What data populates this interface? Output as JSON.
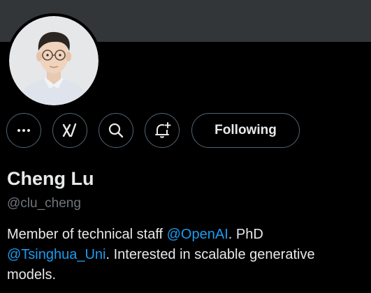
{
  "profile": {
    "display_name": "Cheng Lu",
    "handle": "@clu_cheng",
    "avatar_alt": "avatar",
    "bio": {
      "part1": "Member of technical staff ",
      "mention1": "@OpenAI",
      "part2": ". PhD ",
      "mention2": "@Tsinghua_Uni",
      "part3": ". Interested in scalable generative models."
    }
  },
  "actions": {
    "more_icon": "more-horizontal-icon",
    "grok_icon": "grok-icon",
    "search_icon": "search-icon",
    "notify_icon": "bell-plus-icon",
    "follow_label": "Following"
  },
  "colors": {
    "background": "#000000",
    "banner": "#333639",
    "text": "#e7e9ea",
    "muted": "#71767b",
    "border": "#536471",
    "link": "#1d9bf0"
  }
}
